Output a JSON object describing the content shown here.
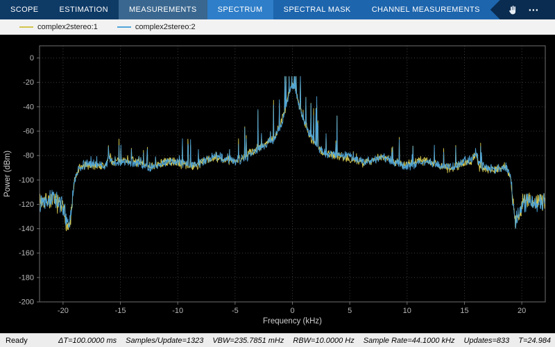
{
  "toolbar": {
    "tabs": [
      {
        "label": "SCOPE",
        "active": false
      },
      {
        "label": "ESTIMATION",
        "active": false
      },
      {
        "label": "MEASUREMENTS",
        "active": true
      },
      {
        "label": "SPECTRUM",
        "active": true
      },
      {
        "label": "SPECTRAL MASK",
        "active": false
      },
      {
        "label": "CHANNEL MEASUREMENTS",
        "active": false
      }
    ],
    "overflow_label": "⋯"
  },
  "chart_data": {
    "type": "line",
    "title": "",
    "xlabel": "Frequency (kHz)",
    "ylabel": "Power (dBm)",
    "xlim": [
      -22.05,
      22.05
    ],
    "ylim": [
      -200,
      10
    ],
    "xticks": [
      -20,
      -15,
      -10,
      -5,
      0,
      5,
      10,
      15,
      20
    ],
    "yticks": [
      0,
      -20,
      -40,
      -60,
      -80,
      -100,
      -120,
      -140,
      -160,
      -180,
      -200
    ],
    "grid": true,
    "background": "#000000",
    "legend_position": "top-strip",
    "series": [
      {
        "name": "complex2stereo:1",
        "color": "#d3c54b",
        "seed": 7
      },
      {
        "name": "complex2stereo:2",
        "color": "#4fa5d9",
        "seed": 13
      }
    ],
    "spike_seed": 20240,
    "envelope": [
      [
        -22.05,
        -118
      ],
      [
        -20.6,
        -116
      ],
      [
        -20.0,
        -120
      ],
      [
        -19.7,
        -132
      ],
      [
        -19.45,
        -138
      ],
      [
        -19.2,
        -118
      ],
      [
        -19.0,
        -100
      ],
      [
        -18.6,
        -92
      ],
      [
        -17.5,
        -90
      ],
      [
        -16.3,
        -88
      ],
      [
        -16.0,
        -79
      ],
      [
        -15.6,
        -86
      ],
      [
        -14.0,
        -87
      ],
      [
        -12.0,
        -86
      ],
      [
        -10.0,
        -86
      ],
      [
        -8.0,
        -85
      ],
      [
        -6.0,
        -84
      ],
      [
        -5.0,
        -83
      ],
      [
        -4.0,
        -82
      ],
      [
        -3.0,
        -77
      ],
      [
        -2.5,
        -73
      ],
      [
        -2.0,
        -68
      ],
      [
        -1.5,
        -62
      ],
      [
        -1.0,
        -52
      ],
      [
        -0.6,
        -40
      ],
      [
        -0.3,
        -28
      ],
      [
        0,
        -22
      ],
      [
        0.3,
        -28
      ],
      [
        0.6,
        -40
      ],
      [
        1.0,
        -52
      ],
      [
        1.5,
        -62
      ],
      [
        2.0,
        -68
      ],
      [
        2.5,
        -73
      ],
      [
        3.0,
        -77
      ],
      [
        4.0,
        -82
      ],
      [
        5.0,
        -83
      ],
      [
        6.0,
        -84
      ],
      [
        8.0,
        -85
      ],
      [
        10.0,
        -86
      ],
      [
        12.0,
        -86
      ],
      [
        14.0,
        -87
      ],
      [
        15.6,
        -86
      ],
      [
        16.0,
        -79
      ],
      [
        16.3,
        -88
      ],
      [
        17.5,
        -90
      ],
      [
        18.6,
        -92
      ],
      [
        19.0,
        -100
      ],
      [
        19.2,
        -118
      ],
      [
        19.45,
        -138
      ],
      [
        19.7,
        -132
      ],
      [
        20.0,
        -120
      ],
      [
        20.6,
        -116
      ],
      [
        22.05,
        -118
      ]
    ],
    "noise_regions": [
      {
        "range": [
          -22.05,
          -19.1
        ],
        "db": 9
      },
      {
        "range": [
          -19.1,
          19.1
        ],
        "db": 4.5
      },
      {
        "range": [
          19.1,
          22.05
        ],
        "db": 9
      }
    ],
    "spike_regions": [
      {
        "range": [
          -4.2,
          4.2
        ],
        "prob": 0.12,
        "boost": [
          6,
          40
        ]
      },
      {
        "range": [
          -16.5,
          -4.2
        ],
        "prob": 0.05,
        "boost": [
          4,
          18
        ]
      },
      {
        "range": [
          4.2,
          16.5
        ],
        "prob": 0.05,
        "boost": [
          4,
          18
        ]
      },
      {
        "range": [
          -19.1,
          -16.5
        ],
        "prob": 0.04,
        "boost": [
          3,
          10
        ]
      },
      {
        "range": [
          16.5,
          19.1
        ],
        "prob": 0.04,
        "boost": [
          3,
          10
        ]
      }
    ]
  },
  "status_bar": {
    "ready": "Ready",
    "items": [
      "ΔT=100.0000 ms",
      "Samples/Update=1323",
      "VBW=235.7851 mHz",
      "RBW=10.0000 Hz",
      "Sample Rate=44.1000 kHz",
      "Updates=833",
      "T=24.984"
    ]
  }
}
